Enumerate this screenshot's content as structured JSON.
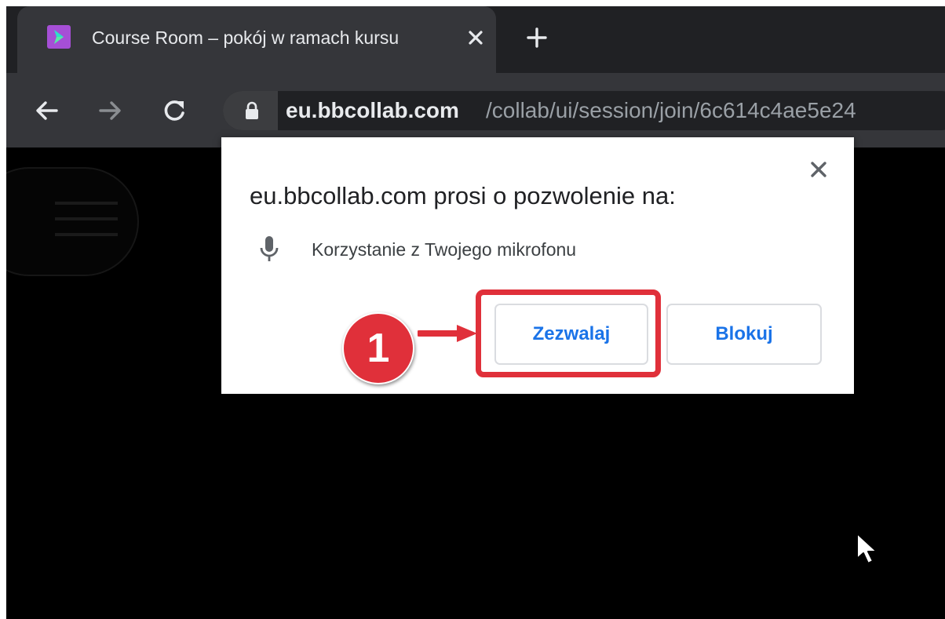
{
  "browser": {
    "tab": {
      "title": "Course Room – pokój w ramach kursu",
      "favicon": "collaborate-favicon-icon",
      "favicon_color": "#a64fd6"
    },
    "new_tab_icon": "plus-icon",
    "nav": {
      "back_icon": "back-arrow-icon",
      "forward_icon": "forward-arrow-icon",
      "reload_icon": "reload-icon"
    },
    "address_bar": {
      "host": "eu.bbcollab.com",
      "path": "/collab/ui/session/join/6c614c4ae5e24",
      "lock_icon": "lock-icon"
    }
  },
  "permission_dialog": {
    "title": "eu.bbcollab.com prosi o pozwolenie na:",
    "permission_icon": "microphone-icon",
    "permission_text": "Korzystanie z Twojego mikrofonu",
    "allow_label": "Zezwalaj",
    "block_label": "Blokuj",
    "close_icon": "close-icon",
    "button_text_color": "#1a73e8"
  },
  "annotation": {
    "step_number": "1",
    "color": "#e0303a"
  }
}
